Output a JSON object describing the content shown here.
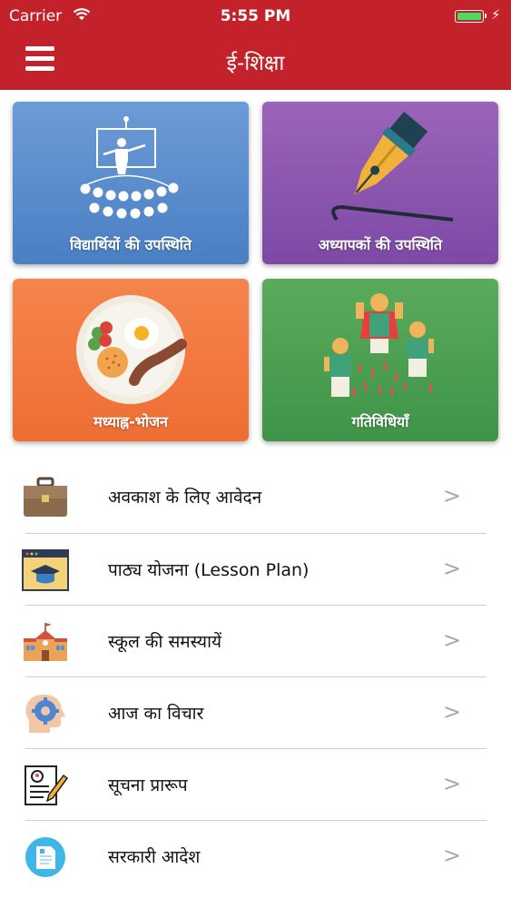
{
  "status_bar": {
    "carrier": "Carrier",
    "time": "5:55 PM"
  },
  "header": {
    "title": "ई-शिक्षा",
    "menu_icon": "hamburger-menu-icon",
    "color": "#c4222a"
  },
  "tiles": [
    {
      "label": "विद्यार्थियों की उपस्थिति",
      "icon": "classroom-icon",
      "color": "#5b8dd0"
    },
    {
      "label": "अध्यापकों की उपस्थिति",
      "icon": "fountain-pen-icon",
      "color": "#8c55b0"
    },
    {
      "label": "मध्याह्न-भोजन",
      "icon": "meal-plate-icon",
      "color": "#f27a41"
    },
    {
      "label": "गतिविधियाँ",
      "icon": "dancing-kids-icon",
      "color": "#4ea052"
    }
  ],
  "menu": {
    "chevron": ">",
    "items": [
      {
        "label": "अवकाश के लिए आवेदन",
        "icon": "briefcase-icon"
      },
      {
        "label": "पाठ्य योजना (Lesson Plan)",
        "icon": "graduation-cap-screen-icon"
      },
      {
        "label": "स्कूल की समस्यायें",
        "icon": "school-building-icon"
      },
      {
        "label": "आज का विचार",
        "icon": "head-gear-icon"
      },
      {
        "label": "सूचना प्रारूप",
        "icon": "form-pencil-icon"
      },
      {
        "label": "सरकारी आदेश",
        "icon": "document-circle-icon"
      }
    ]
  }
}
